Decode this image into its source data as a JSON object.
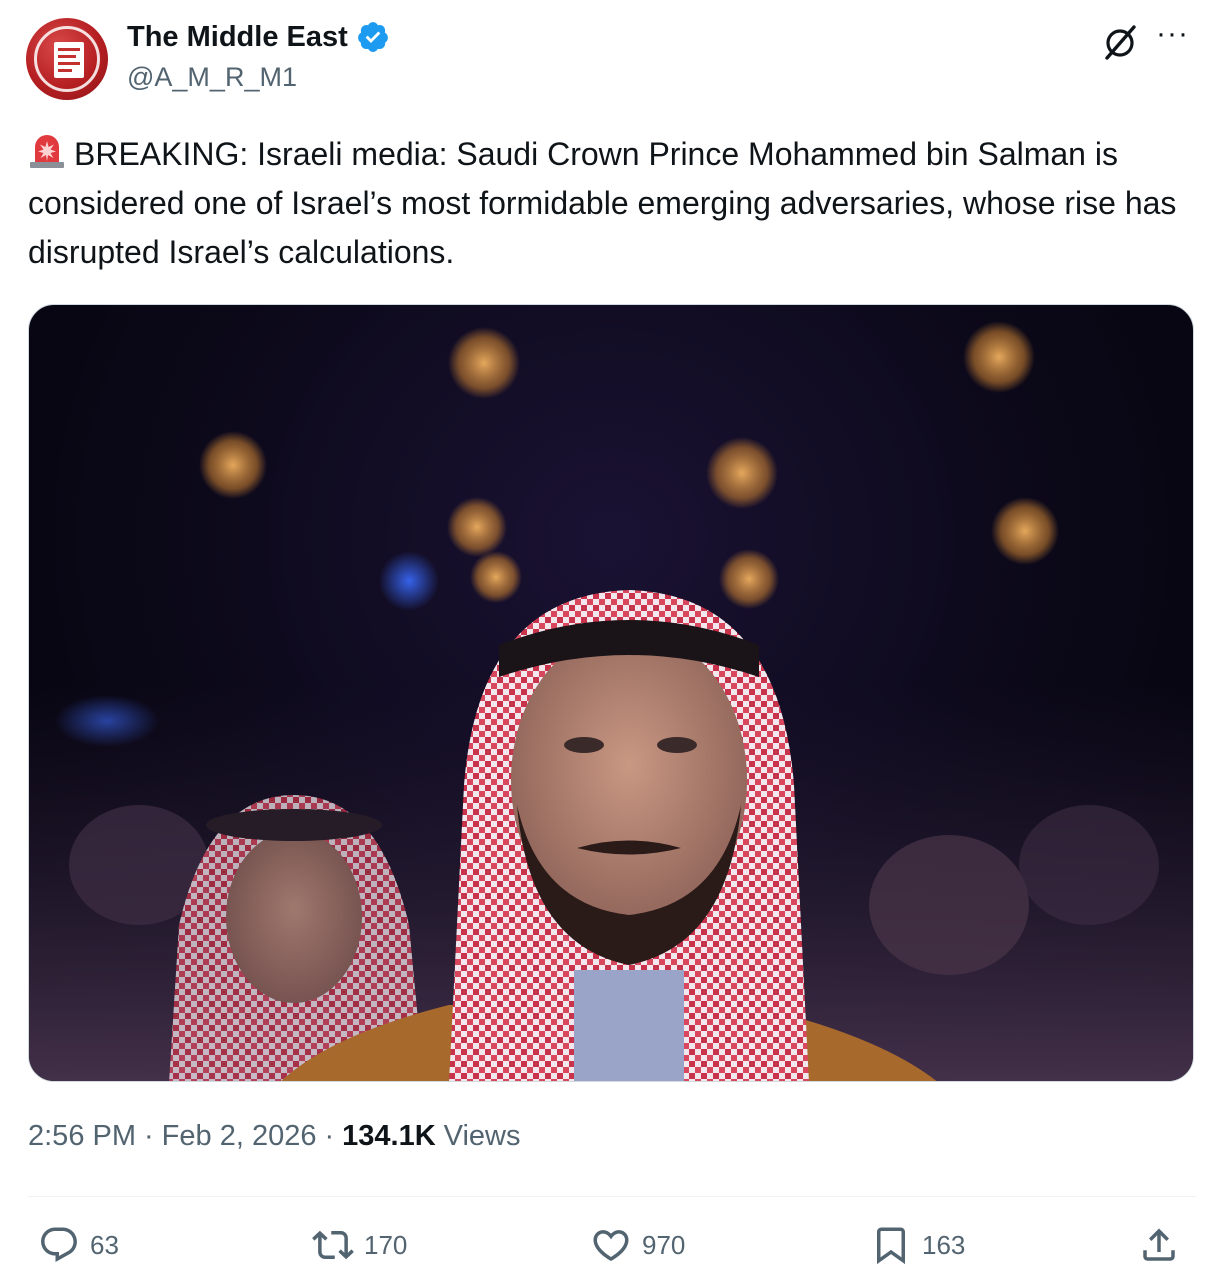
{
  "author": {
    "display_name": "The Middle East",
    "handle": "@A_M_R_M1",
    "verified": true
  },
  "tweet": {
    "text": "BREAKING: Israeli media: Saudi Crown Prince Mohammed bin Salman is considered one of Israel’s most formidable emerging adversaries, whose rise has disrupted Israel’s calculations.",
    "emoji": "police-car-light",
    "time": "2:56 PM",
    "date": "Feb 2, 2026",
    "views_count": "134.1K",
    "views_label": "Views"
  },
  "actions": {
    "replies": "63",
    "reposts": "170",
    "likes": "970",
    "bookmarks": "163"
  },
  "icons": {
    "verified": "verified-badge-icon",
    "grok": "grok-icon",
    "more": "more-icon",
    "reply": "reply-icon",
    "repost": "repost-icon",
    "like": "heart-icon",
    "bookmark": "bookmark-icon",
    "share": "share-icon"
  },
  "colors": {
    "verified_blue": "#1d9bf0",
    "text_primary": "#0f1419",
    "text_secondary": "#536471",
    "avatar_red": "#b51f22"
  }
}
